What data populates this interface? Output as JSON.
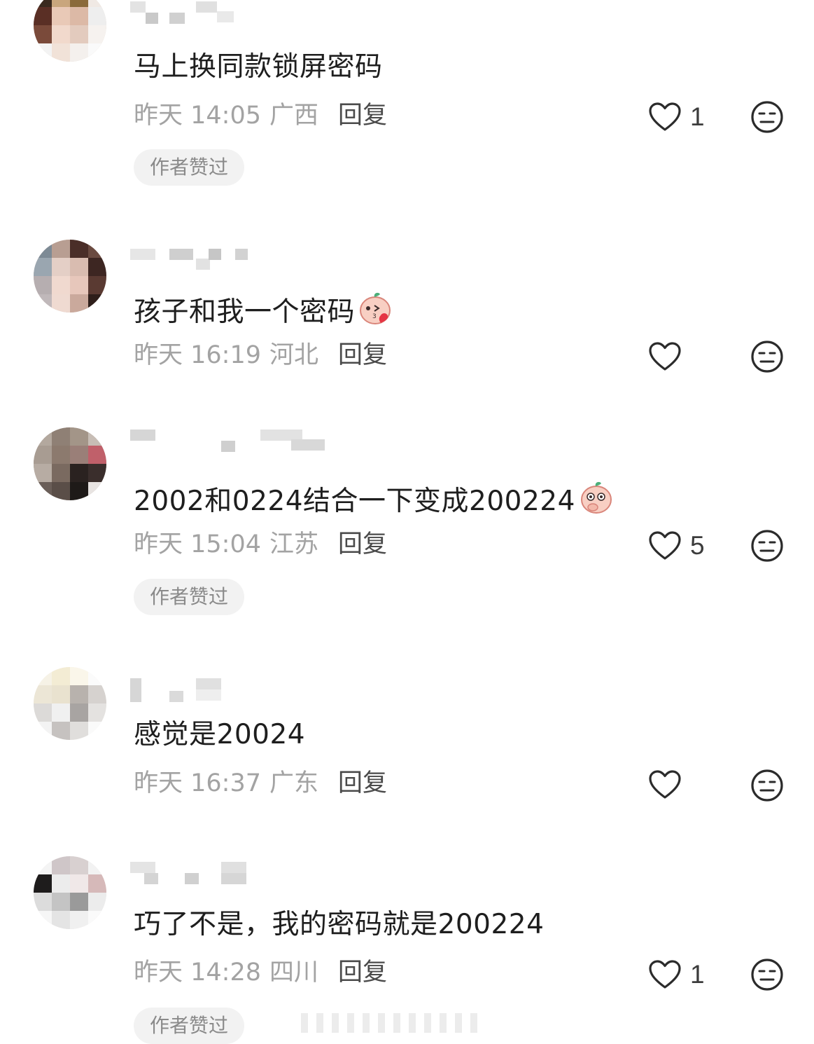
{
  "comments": [
    {
      "text": "马上换同款锁屏密码",
      "time": "昨天 14:05",
      "location": "广西",
      "reply_label": "回复",
      "likes": "1",
      "badge": "作者赞过",
      "emoji": ""
    },
    {
      "text": "孩子和我一个密码",
      "time": "昨天 16:19",
      "location": "河北",
      "reply_label": "回复",
      "likes": "",
      "badge": "",
      "emoji": "kiss-emoji"
    },
    {
      "text": "2002和0224结合一下变成200224",
      "time": "昨天 15:04",
      "location": "江苏",
      "reply_label": "回复",
      "likes": "5",
      "badge": "作者赞过",
      "emoji": "shy-emoji"
    },
    {
      "text": "感觉是20024",
      "time": "昨天 16:37",
      "location": "广东",
      "reply_label": "回复",
      "likes": "",
      "badge": "",
      "emoji": ""
    },
    {
      "text": "巧了不是，我的密码就是200224",
      "time": "昨天 14:28",
      "location": "四川",
      "reply_label": "回复",
      "likes": "1",
      "badge": "作者赞过",
      "emoji": ""
    }
  ],
  "icons": {
    "like": "heart-outline-icon",
    "dislike": "neutral-face-icon"
  },
  "colors": {
    "meta_text": "#a3a3a3",
    "badge_bg": "#f2f2f2",
    "icon_stroke": "#2b2b2b"
  }
}
